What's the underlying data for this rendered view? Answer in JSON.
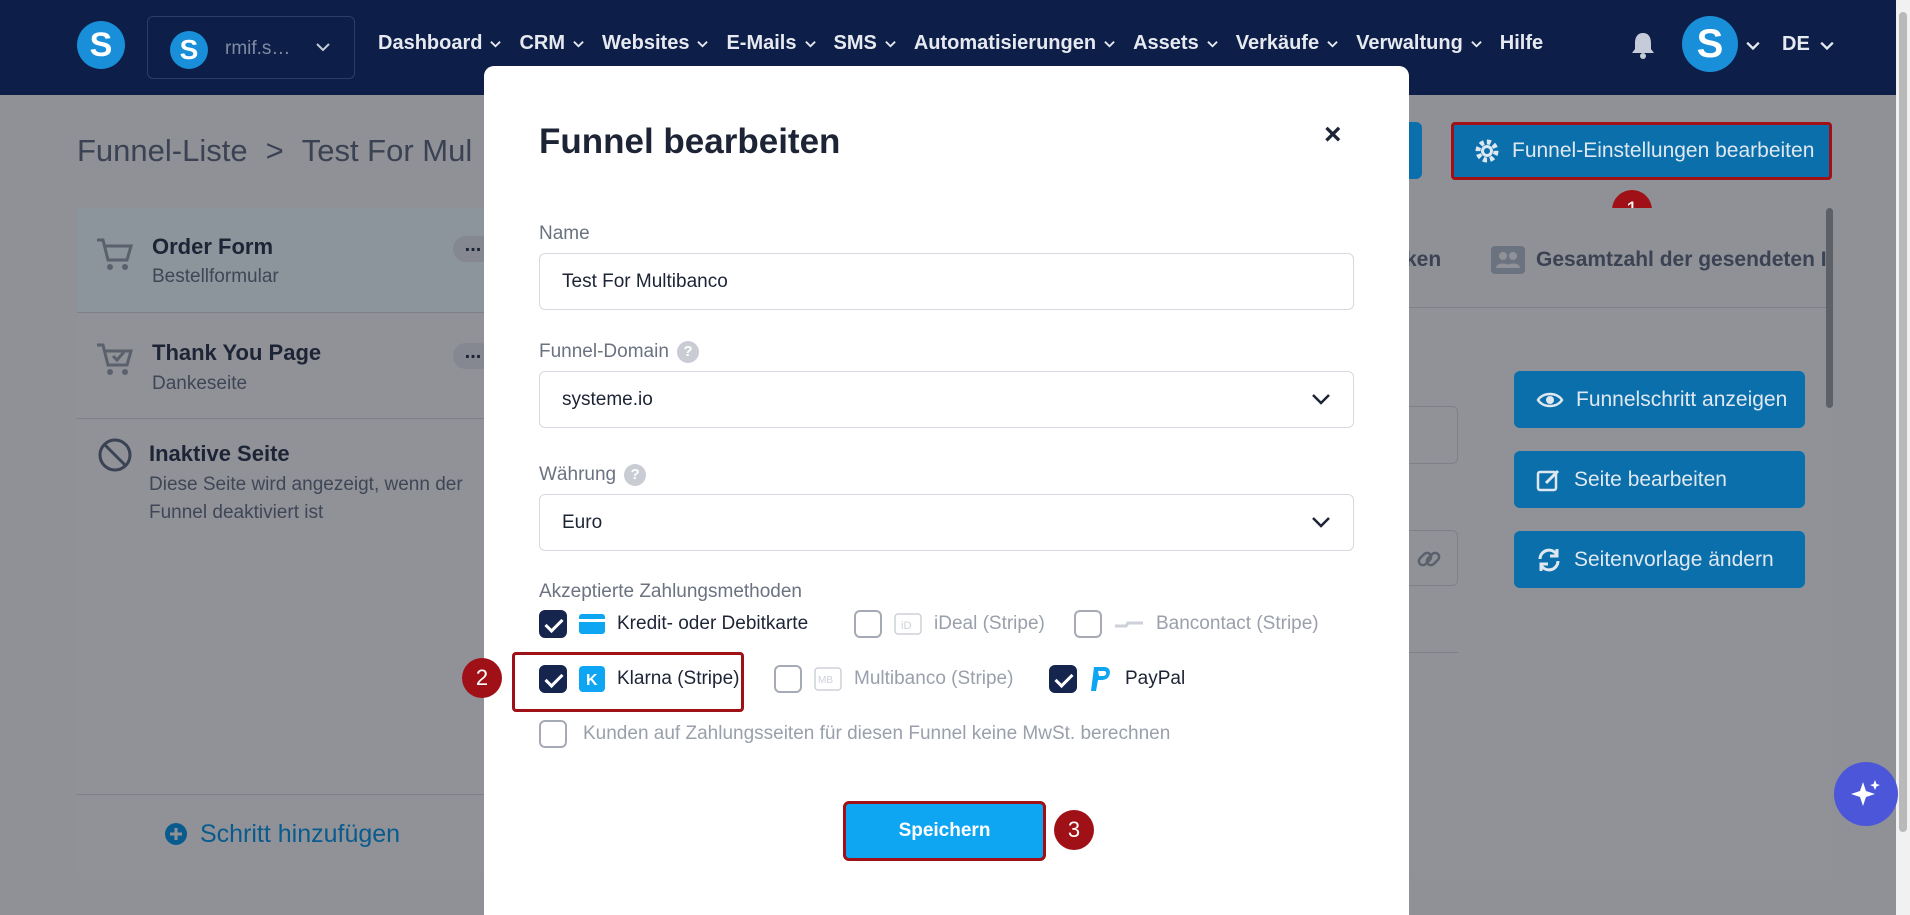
{
  "nav": {
    "logo": "S",
    "workspace_avatar": "S",
    "workspace_name": "rmif.s…",
    "items": [
      "Dashboard",
      "CRM",
      "Websites",
      "E-Mails",
      "SMS",
      "Automatisierungen",
      "Assets",
      "Verkäufe",
      "Verwaltung"
    ],
    "help": "Hilfe",
    "user_avatar": "S",
    "language": "DE"
  },
  "breadcrumb": {
    "root": "Funnel-Liste",
    "separator": ">",
    "current": "Test For Mul"
  },
  "settings_button": "Funnel-Einstellungen bearbeiten",
  "steps": [
    {
      "title": "Order Form",
      "subtitle": "Bestellformular"
    },
    {
      "title": "Thank You Page",
      "subtitle": "Dankeseite"
    },
    {
      "title": "Inaktive Seite",
      "subtitle": "Diese Seite wird angezeigt, wenn der Funnel deaktiviert ist"
    }
  ],
  "add_step": "Schritt hinzufügen",
  "stats_tabs": {
    "partial": "ken",
    "total": "Gesamtzahl der gesendeten I"
  },
  "right_buttons": {
    "view": "Funnelschritt anzeigen",
    "edit": "Seite bearbeiten",
    "template": "Seitenvorlage ändern"
  },
  "modal": {
    "title": "Funnel bearbeiten",
    "close": "×",
    "name_label": "Name",
    "name_value": "Test For Multibanco",
    "domain_label": "Funnel-Domain",
    "domain_value": "systeme.io",
    "currency_label": "Währung",
    "currency_value": "Euro",
    "methods_label": "Akzeptierte Zahlungsmethoden",
    "methods": {
      "card": "Kredit- oder Debitkarte",
      "ideal": "iDeal (Stripe)",
      "bancontact": "Bancontact (Stripe)",
      "klarna": "Klarna (Stripe)",
      "multibanco": "Multibanco (Stripe)",
      "paypal": "PayPal"
    },
    "vat": "Kunden auf Zahlungsseiten für diesen Funnel keine MwSt. berechnen",
    "save": "Speichern"
  },
  "annotations": [
    "1",
    "2",
    "3"
  ],
  "colors": {
    "nav": "#0d1f48",
    "accent": "#0ea5f3",
    "highlight": "#a01017",
    "checked": "#16254e"
  }
}
